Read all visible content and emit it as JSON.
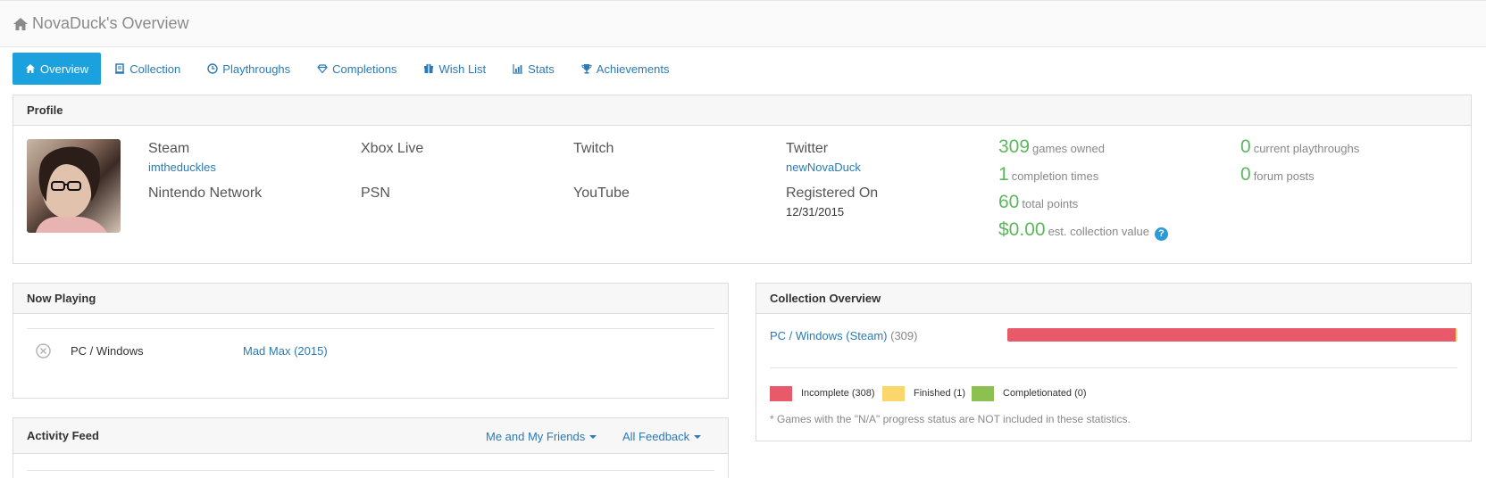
{
  "page": {
    "title": "NovaDuck's Overview"
  },
  "tabs": [
    {
      "label": "Overview",
      "icon": "home-icon",
      "active": true
    },
    {
      "label": "Collection",
      "icon": "collection-icon"
    },
    {
      "label": "Playthroughs",
      "icon": "clock-icon"
    },
    {
      "label": "Completions",
      "icon": "diamond-icon"
    },
    {
      "label": "Wish List",
      "icon": "gift-icon"
    },
    {
      "label": "Stats",
      "icon": "chart-icon"
    },
    {
      "label": "Achievements",
      "icon": "trophy-icon"
    }
  ],
  "profile": {
    "heading": "Profile",
    "steam": {
      "label": "Steam",
      "value": "imtheduckles"
    },
    "xbox": {
      "label": "Xbox Live",
      "value": ""
    },
    "twitch": {
      "label": "Twitch",
      "value": ""
    },
    "twitter": {
      "label": "Twitter",
      "value": "newNovaDuck"
    },
    "nintendo": {
      "label": "Nintendo Network"
    },
    "psn": {
      "label": "PSN"
    },
    "youtube": {
      "label": "YouTube"
    },
    "registered": {
      "label": "Registered On",
      "value": "12/31/2015"
    },
    "stats": {
      "games_owned": {
        "value": "309",
        "label": "games owned"
      },
      "completion_times": {
        "value": "1",
        "label": "completion times"
      },
      "total_points": {
        "value": "60",
        "label": "total points"
      },
      "collection_value": {
        "value": "$0.00",
        "label": "est. collection value"
      },
      "current_playthroughs": {
        "value": "0",
        "label": "current playthroughs"
      },
      "forum_posts": {
        "value": "0",
        "label": "forum posts"
      }
    }
  },
  "now_playing": {
    "heading": "Now Playing",
    "rows": [
      {
        "platform": "PC / Windows",
        "game": "Mad Max (2015)"
      }
    ]
  },
  "activity_feed": {
    "heading": "Activity Feed",
    "filter_who": "Me and My Friends",
    "filter_type": "All Feedback"
  },
  "collection_overview": {
    "heading": "Collection Overview",
    "platform_link": "PC / Windows (Steam)",
    "platform_count": "(309)",
    "progress": {
      "incomplete": 308,
      "finished": 1,
      "completionated": 0,
      "total": 309
    },
    "legend": {
      "incomplete": "Incomplete (308)",
      "finished": "Finished (1)",
      "completionated": "Completionated (0)"
    },
    "note": "* Games with the \"N/A\" progress status are NOT included in these statistics."
  },
  "colors": {
    "accent": "#1ba1dd",
    "link": "#2a7ab5",
    "stat_green": "#5cb85c",
    "incomplete": "#e8596a",
    "finished": "#fbd66a",
    "completionated": "#8cc152"
  }
}
